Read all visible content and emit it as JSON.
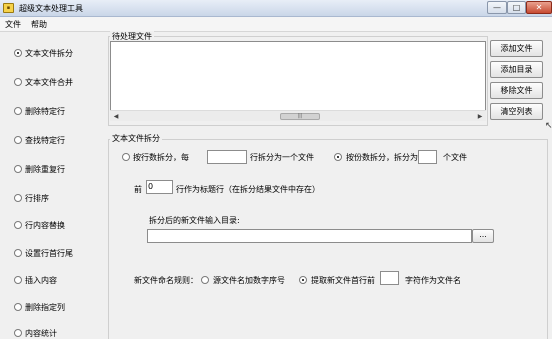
{
  "window": {
    "title": "超级文本处理工具",
    "app_icon": "app-logo-icon",
    "controls": {
      "minimize": "—",
      "maximize": "□",
      "close": "✕"
    }
  },
  "menu": {
    "items": [
      "文件",
      "帮助"
    ]
  },
  "sidebar": {
    "items": [
      {
        "label": "文本文件拆分",
        "checked": true
      },
      {
        "label": "文本文件合并",
        "checked": false
      },
      {
        "label": "删除特定行",
        "checked": false
      },
      {
        "label": "查找特定行",
        "checked": false
      },
      {
        "label": "删除重复行",
        "checked": false
      },
      {
        "label": "行排序",
        "checked": false
      },
      {
        "label": "行内容替换",
        "checked": false
      },
      {
        "label": "设置行首行尾",
        "checked": false
      },
      {
        "label": "插入内容",
        "checked": false
      },
      {
        "label": "删除指定列",
        "checked": false
      },
      {
        "label": "内容统计",
        "checked": false
      }
    ]
  },
  "files_panel": {
    "legend": "待处理文件",
    "scroll_thumb": "|||",
    "scroll_left": "◀",
    "scroll_right": "▶",
    "buttons": [
      "添加文件",
      "添加目录",
      "移除文件",
      "清空列表"
    ]
  },
  "split_panel": {
    "legend": "文本文件拆分",
    "by_rows": {
      "prefix": "按行数拆分，每",
      "suffix": "行拆分为一个文件",
      "value": "",
      "checked": false
    },
    "by_count": {
      "prefix": "按份数拆分，拆分为",
      "suffix": "个文件",
      "value": "",
      "checked": true
    },
    "title_rows": {
      "prefix": "前",
      "value": "0",
      "suffix": "行作为标题行（在拆分结果文件中存在）"
    },
    "output_dir_label": "拆分后的新文件输入目录:",
    "output_dir_value": "",
    "browse_label": "...",
    "naming": {
      "label": "新文件命名规则：",
      "option_source": "源文件名加数字序号",
      "option_source_checked": false,
      "option_firstline_prefix": "提取新文件首行前",
      "option_firstline_checked": true,
      "option_firstline_value": "",
      "option_firstline_suffix": "字符作为文件名"
    }
  }
}
